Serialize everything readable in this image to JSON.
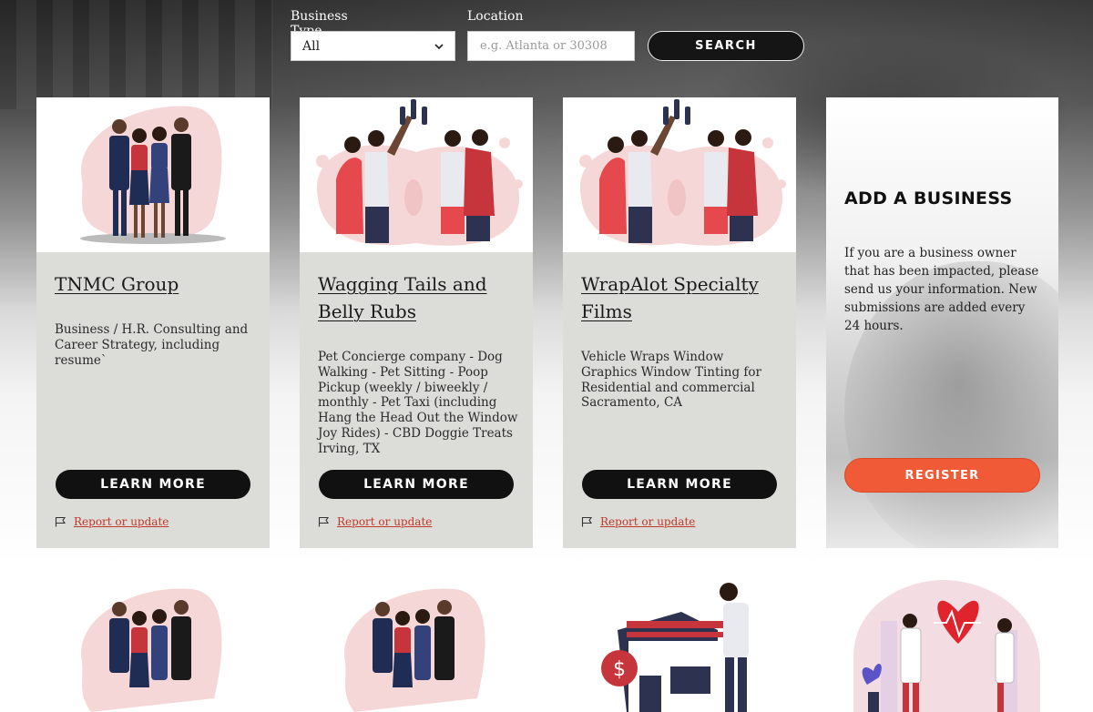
{
  "search": {
    "business_type_label": "Business Type",
    "business_type_value": "All",
    "location_label": "Location",
    "location_placeholder": "e.g. Atlanta or 30308",
    "search_label": "SEARCH"
  },
  "cards": [
    {
      "title": "TNMC Group",
      "description": "Business / H.R. Consulting and Career Strategy, including resume`",
      "learn_more": "LEARN MORE",
      "report": "Report or update",
      "image": "business-team-illustration"
    },
    {
      "title": "Wagging Tails and Belly Rubs",
      "description": "Pet Concierge company - Dog Walking - Pet Sitting - Poop Pickup (weekly / biweekly / monthly - Pet Taxi (including Hang the Head Out the Window Joy Rides) - CBD Doggie Treats Irving, TX",
      "learn_more": "LEARN MORE",
      "report": "Report or update",
      "image": "celebration-toast-illustration"
    },
    {
      "title": "WrapAlot Specialty Films",
      "description": "Vehicle Wraps Window Graphics Window Tinting for Residential and commercial Sacramento, CA",
      "learn_more": "LEARN MORE",
      "report": "Report or update",
      "image": "celebration-toast-illustration"
    }
  ],
  "add_business": {
    "title": "ADD A BUSINESS",
    "description": "If you are a business owner that has been impacted, please send us your information. New submissions are added every 24 hours.",
    "register_label": "REGISTER"
  },
  "second_row_images": [
    "business-team-illustration",
    "business-team-illustration",
    "storefront-illustration",
    "healthcare-illustration"
  ],
  "colors": {
    "accent": "#f05a36",
    "link": "#c0392b",
    "card_bg": "#dcdcd8",
    "button_dark": "#111111"
  }
}
